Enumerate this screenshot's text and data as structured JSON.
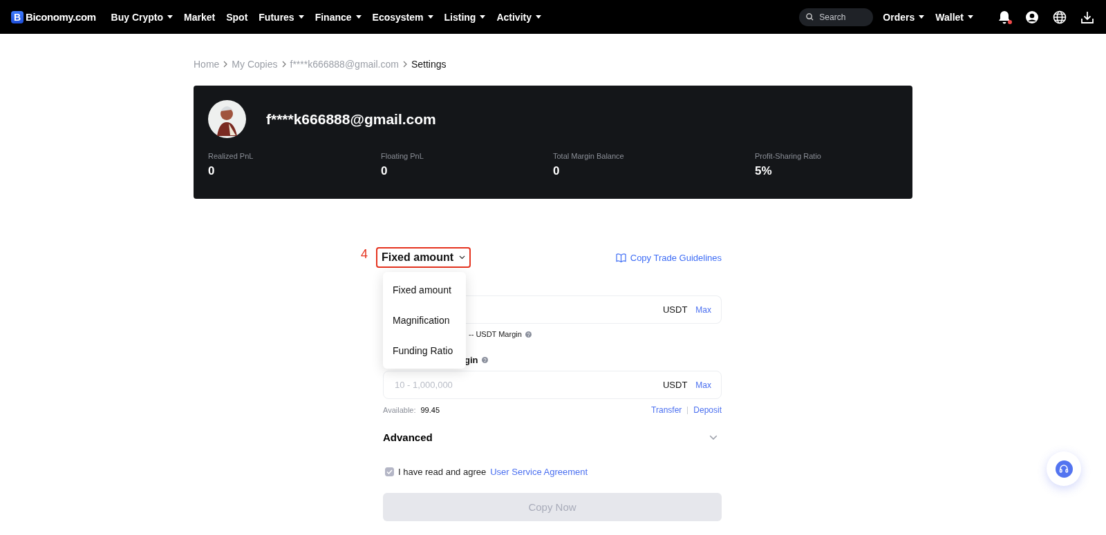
{
  "nav": {
    "logo_mark": "B",
    "logo_text": "Biconomy.com",
    "items": [
      {
        "label": "Buy Crypto",
        "dropdown": true
      },
      {
        "label": "Market",
        "dropdown": false
      },
      {
        "label": "Spot",
        "dropdown": false
      },
      {
        "label": "Futures",
        "dropdown": true
      },
      {
        "label": "Finance",
        "dropdown": true
      },
      {
        "label": "Ecosystem",
        "dropdown": true
      },
      {
        "label": "Listing",
        "dropdown": true
      },
      {
        "label": "Activity",
        "dropdown": true
      }
    ],
    "search": {
      "placeholder": "Search"
    },
    "right_items": [
      {
        "label": "Orders",
        "dropdown": true
      },
      {
        "label": "Wallet",
        "dropdown": true
      }
    ],
    "notification_dot": true
  },
  "breadcrumb": [
    {
      "label": "Home",
      "current": false
    },
    {
      "label": "My Copies",
      "current": false
    },
    {
      "label": "f****k666888@gmail.com",
      "current": false
    },
    {
      "label": "Settings",
      "current": true
    }
  ],
  "profile": {
    "name": "f****k666888@gmail.com",
    "stats": [
      {
        "label": "Realized PnL",
        "value": "0"
      },
      {
        "label": "Floating PnL",
        "value": "0"
      },
      {
        "label": "Total Margin Balance",
        "value": "0"
      },
      {
        "label": "Profit-Sharing Ratio",
        "value": "5%"
      }
    ]
  },
  "form": {
    "annotation": "4",
    "mode": "Fixed amount",
    "guidelines": "Copy Trade Guidelines",
    "mode_options": [
      {
        "label": "Fixed amount"
      },
      {
        "label": "Magnification"
      },
      {
        "label": "Funding Ratio"
      }
    ],
    "field_1": {
      "unit": "USDT",
      "max": "Max",
      "note": "-- USDT Margin"
    },
    "field_2": {
      "label": "gin",
      "placeholder": "10 - 1,000,000",
      "unit": "USDT",
      "max": "Max",
      "available_label": "Available:",
      "available": "99.45",
      "transfer": "Transfer",
      "deposit": "Deposit"
    },
    "advanced": {
      "label": "Advanced",
      "expanded": false
    },
    "agree": {
      "checked": true,
      "text": "I have read and agree",
      "link": "User Service Agreement"
    },
    "submit": {
      "label": "Copy Now",
      "disabled": true
    }
  }
}
